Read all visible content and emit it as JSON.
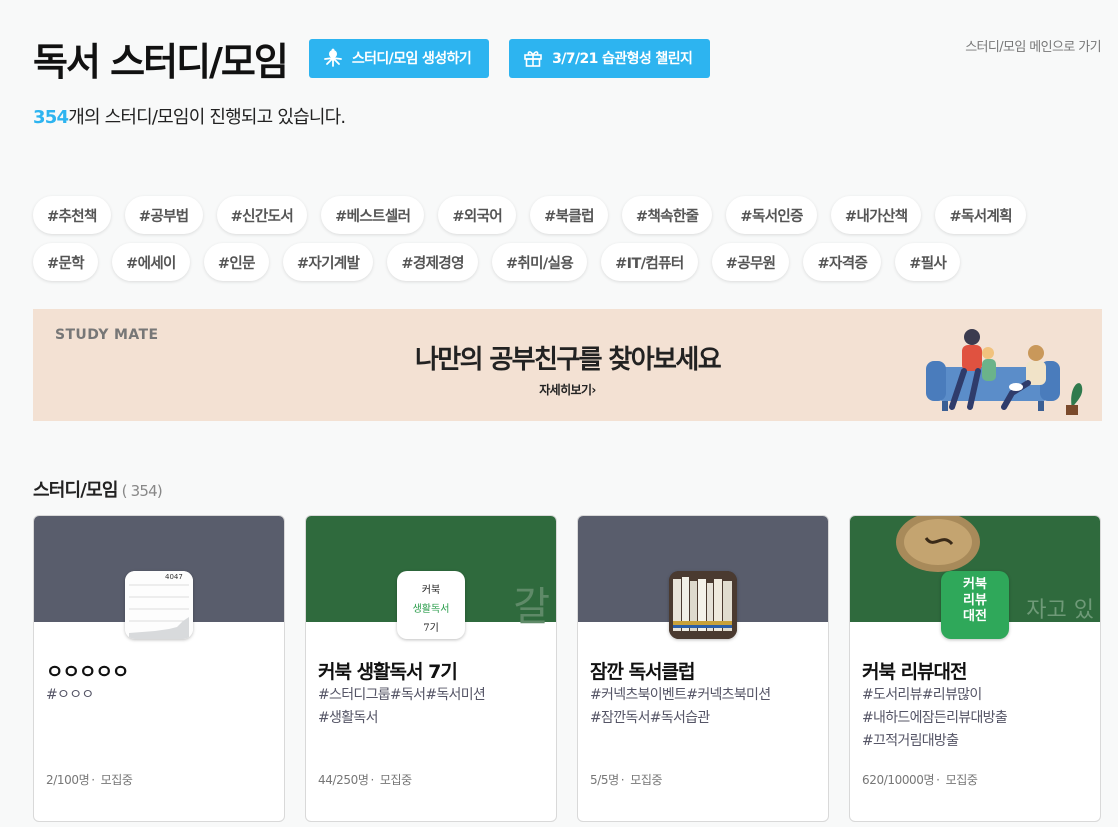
{
  "header": {
    "title": "독서 스터디/모임",
    "create_button": "스터디/모임 생성하기",
    "challenge_button": "3/7/21 습관형성 챌린지",
    "main_link": "스터디/모임 메인으로 가기"
  },
  "summary": {
    "count": "354",
    "text": "개의 스터디/모임이 진행되고 있습니다."
  },
  "tags": {
    "row1": [
      "#추천책",
      "#공부법",
      "#신간도서",
      "#베스트셀러",
      "#외국어",
      "#북클럽",
      "#책속한줄",
      "#독서인증",
      "#내가산책",
      "#독서계획"
    ],
    "row2": [
      "#문학",
      "#에세이",
      "#인문",
      "#자기계발",
      "#경제경영",
      "#취미/실용",
      "#IT/컴퓨터",
      "#공무원",
      "#자격증",
      "#필사"
    ]
  },
  "banner": {
    "brand": "STUDY MATE",
    "headline": "나만의 공부친구를 찾아보세요",
    "more": "자세히보기›"
  },
  "section": {
    "title": "스터디/모임",
    "count": "( 354)"
  },
  "cards": [
    {
      "title": "ㅇㅇㅇㅇㅇ",
      "tags_line1": "#ㅇㅇㅇ",
      "tags_line2": "",
      "tags_line3": "",
      "members": "2/100명",
      "status": "모집중",
      "cover_color": "#595d6c",
      "thumb_text": "4047"
    },
    {
      "title": "커북 생활독서 7기",
      "tags_line1": "#스터디그룹#독서#독서미션",
      "tags_line2": "#생활독서",
      "tags_line3": "",
      "members": "44/250명",
      "status": "모집중",
      "cover_color": "#2f6a3d",
      "thumb_line1": "커북",
      "thumb_line2": "생활독서",
      "thumb_line3": "7기"
    },
    {
      "title": "잠깐 독서클럽",
      "tags_line1": "#커넥츠북이벤트#커넥츠북미션",
      "tags_line2": "#잠깐독서#독서습관",
      "tags_line3": "",
      "members": "5/5명",
      "status": "모집중",
      "cover_color": "#595d6c"
    },
    {
      "title": "커북 리뷰대전",
      "tags_line1": "#도서리뷰#리뷰많이",
      "tags_line2": "#내하드에잠든리뷰대방출",
      "tags_line3": "#끄적거림대방출",
      "members": "620/10000명",
      "status": "모집중",
      "cover_color": "#2f6a3d",
      "thumb_line1": "커북",
      "thumb_line2": "리뷰",
      "thumb_line3": "대전"
    }
  ],
  "colors": {
    "accent": "#2db4f0",
    "banner_bg": "#f3e1d3"
  },
  "icons": {
    "create": "octopus-icon",
    "challenge": "gift-icon"
  }
}
